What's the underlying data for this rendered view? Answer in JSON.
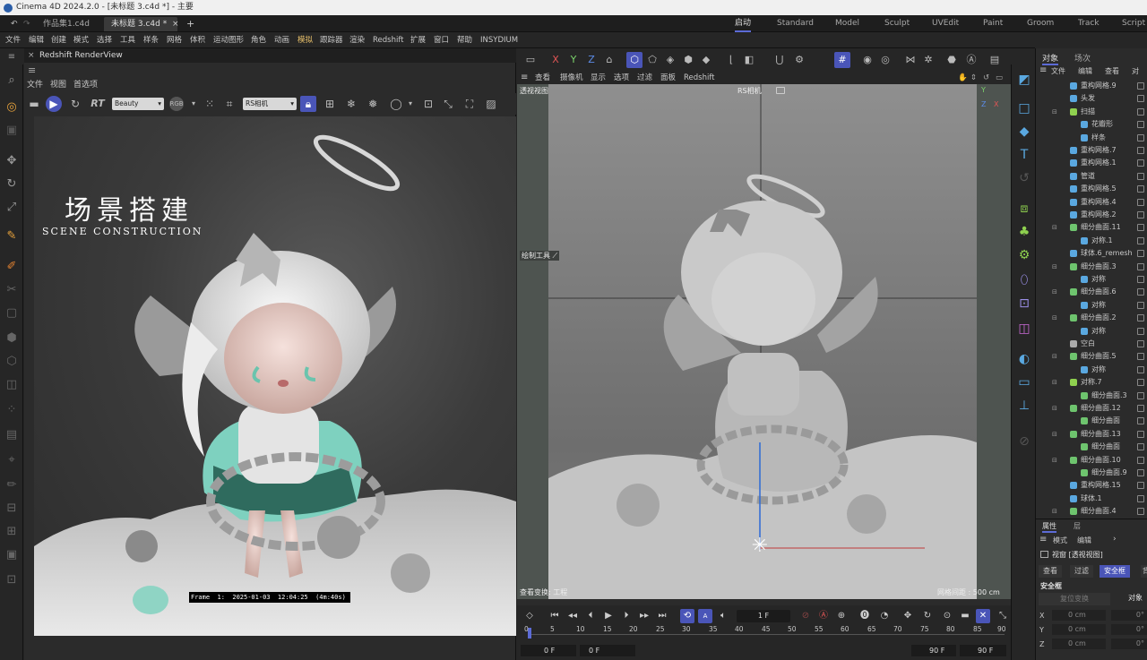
{
  "window_title": "Cinema 4D 2024.2.0 - [未标题 3.c4d *] - 主要",
  "file_tabs": [
    "作品集1.c4d",
    "未标题 3.c4d *"
  ],
  "layout_tabs": [
    "启动",
    "Standard",
    "Model",
    "Sculpt",
    "UVEdit",
    "Paint",
    "Groom",
    "Track",
    "Script"
  ],
  "menu": [
    "文件",
    "编辑",
    "创建",
    "模式",
    "选择",
    "工具",
    "样条",
    "网格",
    "体积",
    "运动图形",
    "角色",
    "动画",
    "模拟",
    "跟踪器",
    "渲染",
    "Redshift",
    "扩展",
    "窗口",
    "帮助",
    "INSYDIUM"
  ],
  "renderview": {
    "title": "Redshift RenderView",
    "menu": [
      "文件",
      "视图",
      "首选项"
    ],
    "rt_label": "RT",
    "pass_select": "Beauty",
    "rgb_label": "RGB",
    "camera_select": "RS相机",
    "overlay_title": "场景搭建",
    "overlay_subtitle": "SCENE CONSTRUCTION",
    "frame_info": "Frame  1:  2025-01-03  12:04:25  (4m:40s)"
  },
  "viewport": {
    "menu": [
      "查看",
      "摄像机",
      "显示",
      "选项",
      "过滤",
      "面板",
      "Redshift"
    ],
    "label": "透视视图",
    "camera": "RS相机",
    "draw_tool": "绘制工具",
    "bottom_left": "查看变换: 工程",
    "grid_info": "网格间距 : 500 cm"
  },
  "timeline": {
    "current_frame": "1 F",
    "ticks": [
      "0",
      "5",
      "10",
      "15",
      "20",
      "25",
      "30",
      "35",
      "40",
      "45",
      "50",
      "55",
      "60",
      "65",
      "70",
      "75",
      "80",
      "85",
      "90"
    ],
    "start": "0 F",
    "start2": "0 F",
    "end": "90 F",
    "end2": "90 F"
  },
  "object_manager": {
    "tabs": [
      "对象",
      "场次"
    ],
    "menu": [
      "文件",
      "编辑",
      "查看",
      "对"
    ],
    "items": [
      {
        "name": "重构网格.9",
        "indent": 1,
        "icon": "#5aa8e0",
        "tri": ""
      },
      {
        "name": "头发",
        "indent": 1,
        "icon": "#5aa8e0",
        "tri": ""
      },
      {
        "name": "扫描",
        "indent": 1,
        "icon": "#8fd14f",
        "tri": "⊟"
      },
      {
        "name": "花瓣形",
        "indent": 2,
        "icon": "#5aa8e0",
        "tri": ""
      },
      {
        "name": "样条",
        "indent": 2,
        "icon": "#5aa8e0",
        "tri": ""
      },
      {
        "name": "重构网格.7",
        "indent": 1,
        "icon": "#5aa8e0",
        "tri": ""
      },
      {
        "name": "重构网格.1",
        "indent": 1,
        "icon": "#5aa8e0",
        "tri": ""
      },
      {
        "name": "管道",
        "indent": 1,
        "icon": "#5aa8e0",
        "tri": ""
      },
      {
        "name": "重构网格.5",
        "indent": 1,
        "icon": "#5aa8e0",
        "tri": ""
      },
      {
        "name": "重构网格.4",
        "indent": 1,
        "icon": "#5aa8e0",
        "tri": ""
      },
      {
        "name": "重构网格.2",
        "indent": 1,
        "icon": "#5aa8e0",
        "tri": ""
      },
      {
        "name": "细分曲面.11",
        "indent": 1,
        "icon": "#6ec46e",
        "tri": "⊟"
      },
      {
        "name": "对称.1",
        "indent": 2,
        "icon": "#5aa8e0",
        "tri": ""
      },
      {
        "name": "球体.6_remesh",
        "indent": 1,
        "icon": "#5aa8e0",
        "tri": ""
      },
      {
        "name": "细分曲面.3",
        "indent": 1,
        "icon": "#6ec46e",
        "tri": "⊟"
      },
      {
        "name": "对称",
        "indent": 2,
        "icon": "#5aa8e0",
        "tri": ""
      },
      {
        "name": "细分曲面.6",
        "indent": 1,
        "icon": "#6ec46e",
        "tri": "⊟"
      },
      {
        "name": "对称",
        "indent": 2,
        "icon": "#5aa8e0",
        "tri": ""
      },
      {
        "name": "细分曲面.2",
        "indent": 1,
        "icon": "#6ec46e",
        "tri": "⊟"
      },
      {
        "name": "对称",
        "indent": 2,
        "icon": "#5aa8e0",
        "tri": ""
      },
      {
        "name": "空白",
        "indent": 1,
        "icon": "#aaaaaa",
        "tri": ""
      },
      {
        "name": "细分曲面.5",
        "indent": 1,
        "icon": "#6ec46e",
        "tri": "⊟"
      },
      {
        "name": "对称",
        "indent": 2,
        "icon": "#5aa8e0",
        "tri": ""
      },
      {
        "name": "对称.7",
        "indent": 1,
        "icon": "#8fd14f",
        "tri": "⊟"
      },
      {
        "name": "细分曲面.3",
        "indent": 2,
        "icon": "#6ec46e",
        "tri": ""
      },
      {
        "name": "细分曲面.12",
        "indent": 1,
        "icon": "#6ec46e",
        "tri": "⊟"
      },
      {
        "name": "细分曲面",
        "indent": 2,
        "icon": "#6ec46e",
        "tri": ""
      },
      {
        "name": "细分曲面.13",
        "indent": 1,
        "icon": "#6ec46e",
        "tri": "⊟"
      },
      {
        "name": "细分曲面",
        "indent": 2,
        "icon": "#6ec46e",
        "tri": ""
      },
      {
        "name": "细分曲面.10",
        "indent": 1,
        "icon": "#6ec46e",
        "tri": "⊟"
      },
      {
        "name": "细分曲面.9",
        "indent": 2,
        "icon": "#6ec46e",
        "tri": ""
      },
      {
        "name": "重构网格.15",
        "indent": 1,
        "icon": "#5aa8e0",
        "tri": ""
      },
      {
        "name": "球体.1",
        "indent": 1,
        "icon": "#5aa8e0",
        "tri": ""
      },
      {
        "name": "细分曲面.4",
        "indent": 1,
        "icon": "#6ec46e",
        "tri": "⊟"
      }
    ]
  },
  "attributes": {
    "tabs": [
      "属性",
      "层"
    ],
    "menu": [
      "模式",
      "编辑"
    ],
    "title": "视窗 [透视视图]",
    "subtabs": [
      "查看",
      "过滤",
      "安全框",
      "背"
    ],
    "section": "安全框",
    "reset_label": "复位变换",
    "obj_label": "对象",
    "rows": [
      {
        "axis": "X",
        "value": "0 cm",
        "deg": "0°"
      },
      {
        "axis": "Y",
        "value": "0 cm",
        "deg": "0°"
      },
      {
        "axis": "Z",
        "value": "0 cm",
        "deg": "0°"
      }
    ]
  },
  "colors": {
    "accent": "#5c6bd6",
    "active_tab": "#4a55b8",
    "teal": "#7fd6c4"
  }
}
